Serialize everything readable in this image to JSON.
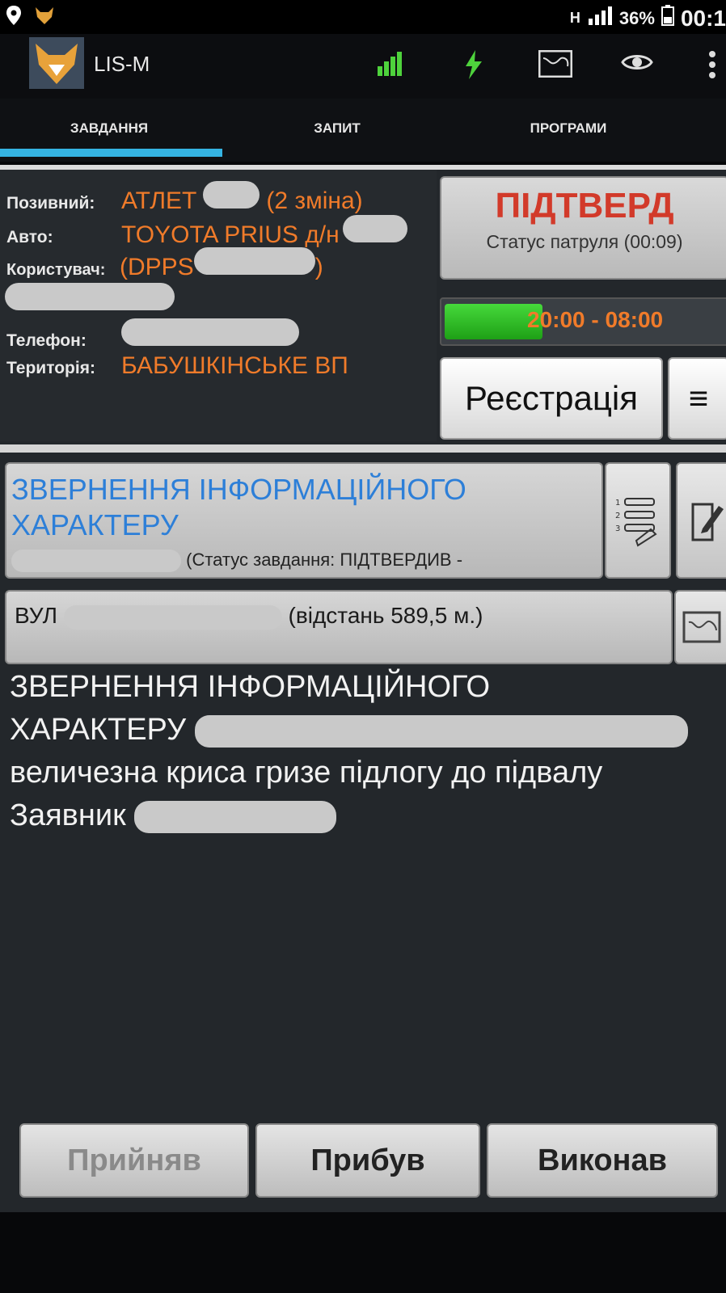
{
  "status_bar": {
    "location_icon": "location-pin-icon",
    "notif_icon": "fox-notification-icon",
    "network_type": "H",
    "battery_percent": "36%",
    "time": "00:1"
  },
  "action_bar": {
    "title": "LIS-M",
    "icons": [
      "signal-bars-icon",
      "gps-charge-icon",
      "map-icon",
      "eye-icon",
      "overflow-menu-icon"
    ]
  },
  "tabs": [
    {
      "label": "ЗАВДАННЯ",
      "active": true
    },
    {
      "label": "ЗАПИТ",
      "active": false
    },
    {
      "label": "ПРОГРАМИ",
      "active": false
    }
  ],
  "patrol_info": {
    "callsign_label": "Позивний:",
    "callsign_value": "АТЛЕТ",
    "callsign_suffix": "(2 зміна)",
    "car_label": "Авто:",
    "car_value": "TOYOTA PRIUS д/н",
    "user_label": "Користувач:",
    "user_value": "(DPPS",
    "user_suffix": ")",
    "phone_label": "Телефон:",
    "territory_label": "Територія:",
    "territory_value": "БАБУШКІНСЬКЕ ВП"
  },
  "patrol_status": {
    "title": "ПІДТВЕРД",
    "subtitle": "Статус патруля (00:09)"
  },
  "shift": {
    "time_range": "20:00 - 08:00",
    "progress": 0.35
  },
  "buttons": {
    "registration": "Реєстрація",
    "menu": "≡"
  },
  "task": {
    "title": "ЗВЕРНЕННЯ ІНФОРМАЦІЙНОГО ХАРАКТЕРУ",
    "status_text": "(Статус завдання: ПІДТВЕРДИВ -",
    "address_prefix": "ВУЛ",
    "distance_text": "(відстань 589,5 м.)",
    "desc_line1": "ЗВЕРНЕННЯ ІНФОРМАЦІЙНОГО",
    "desc_line2": "ХАРАКТЕРУ",
    "desc_line3": "величезна криса гризе підлогу до підвалу",
    "desc_line4": "Заявник"
  },
  "actions": {
    "accepted": "Прийняв",
    "arrived": "Прибув",
    "completed": "Виконав"
  },
  "colors": {
    "accent_blue": "#35b4e3",
    "orange": "#f07b2a",
    "red": "#d23a2a",
    "task_blue": "#2d7fd8"
  }
}
